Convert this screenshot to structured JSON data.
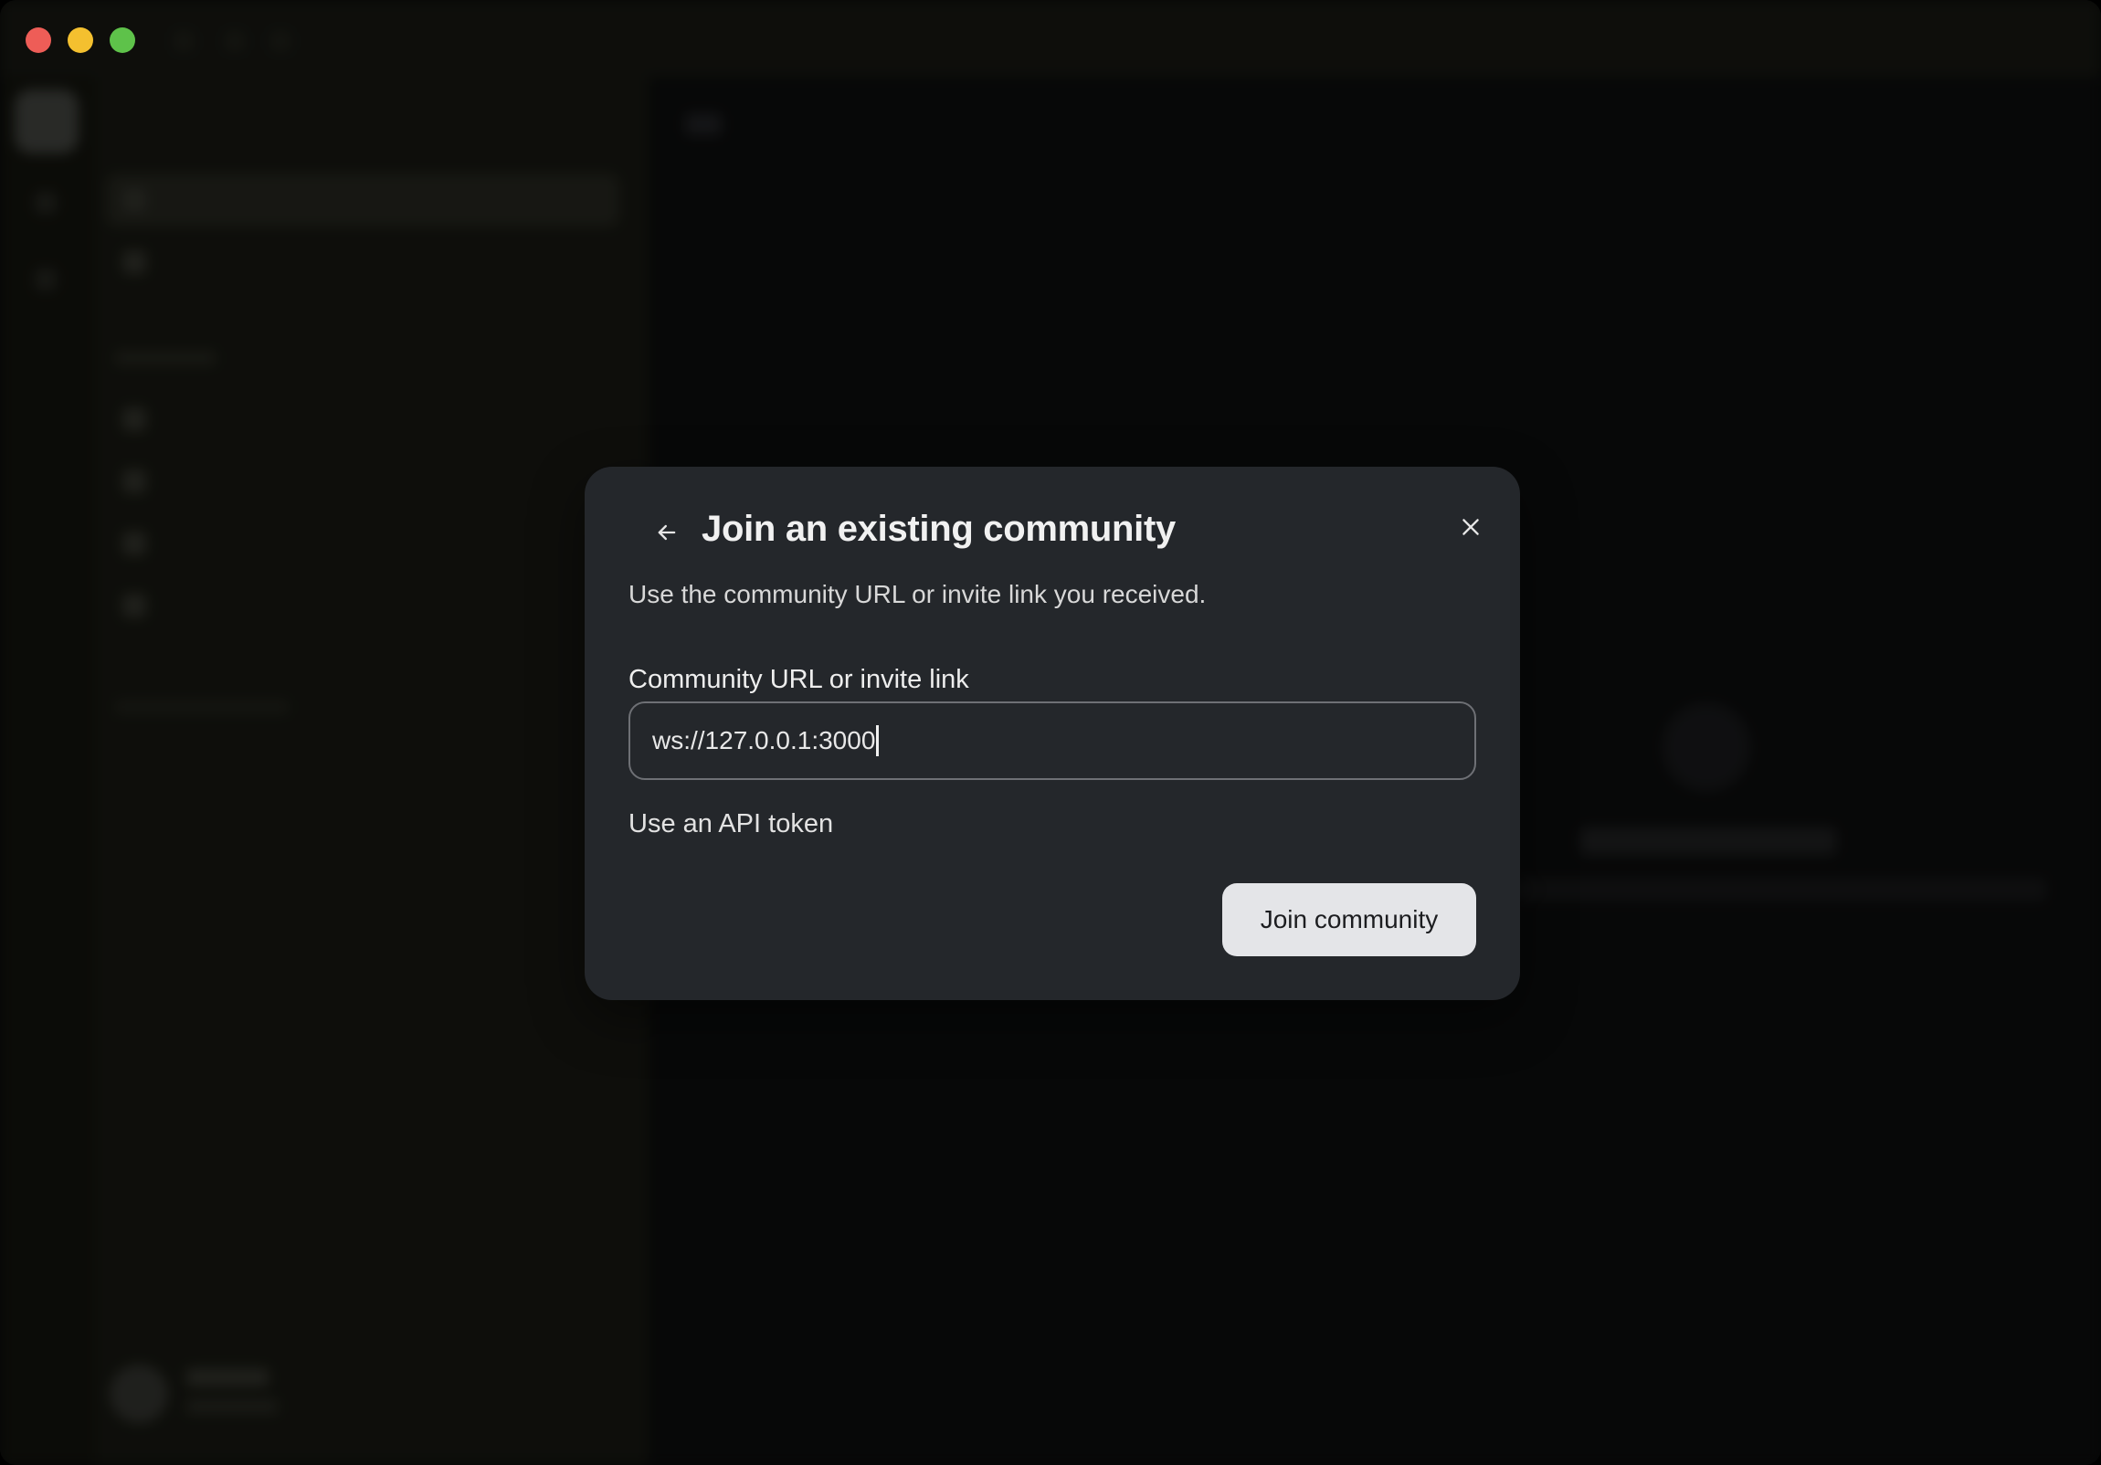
{
  "dialog": {
    "title": "Join an existing community",
    "subtitle": "Use the community URL or invite link you received.",
    "field_label": "Community URL or invite link",
    "field_value": "ws://127.0.0.1:3000",
    "token_link": "Use an API token",
    "join_button": "Join community"
  },
  "icons": {
    "back": "arrow-left-icon",
    "close": "close-icon"
  },
  "colors": {
    "dialog_bg": "#24272b",
    "primary_button_bg": "#e4e5e8",
    "close_red": "#ee5d57",
    "minimize_yellow": "#f4c02f",
    "zoom_green": "#5ec24a"
  }
}
